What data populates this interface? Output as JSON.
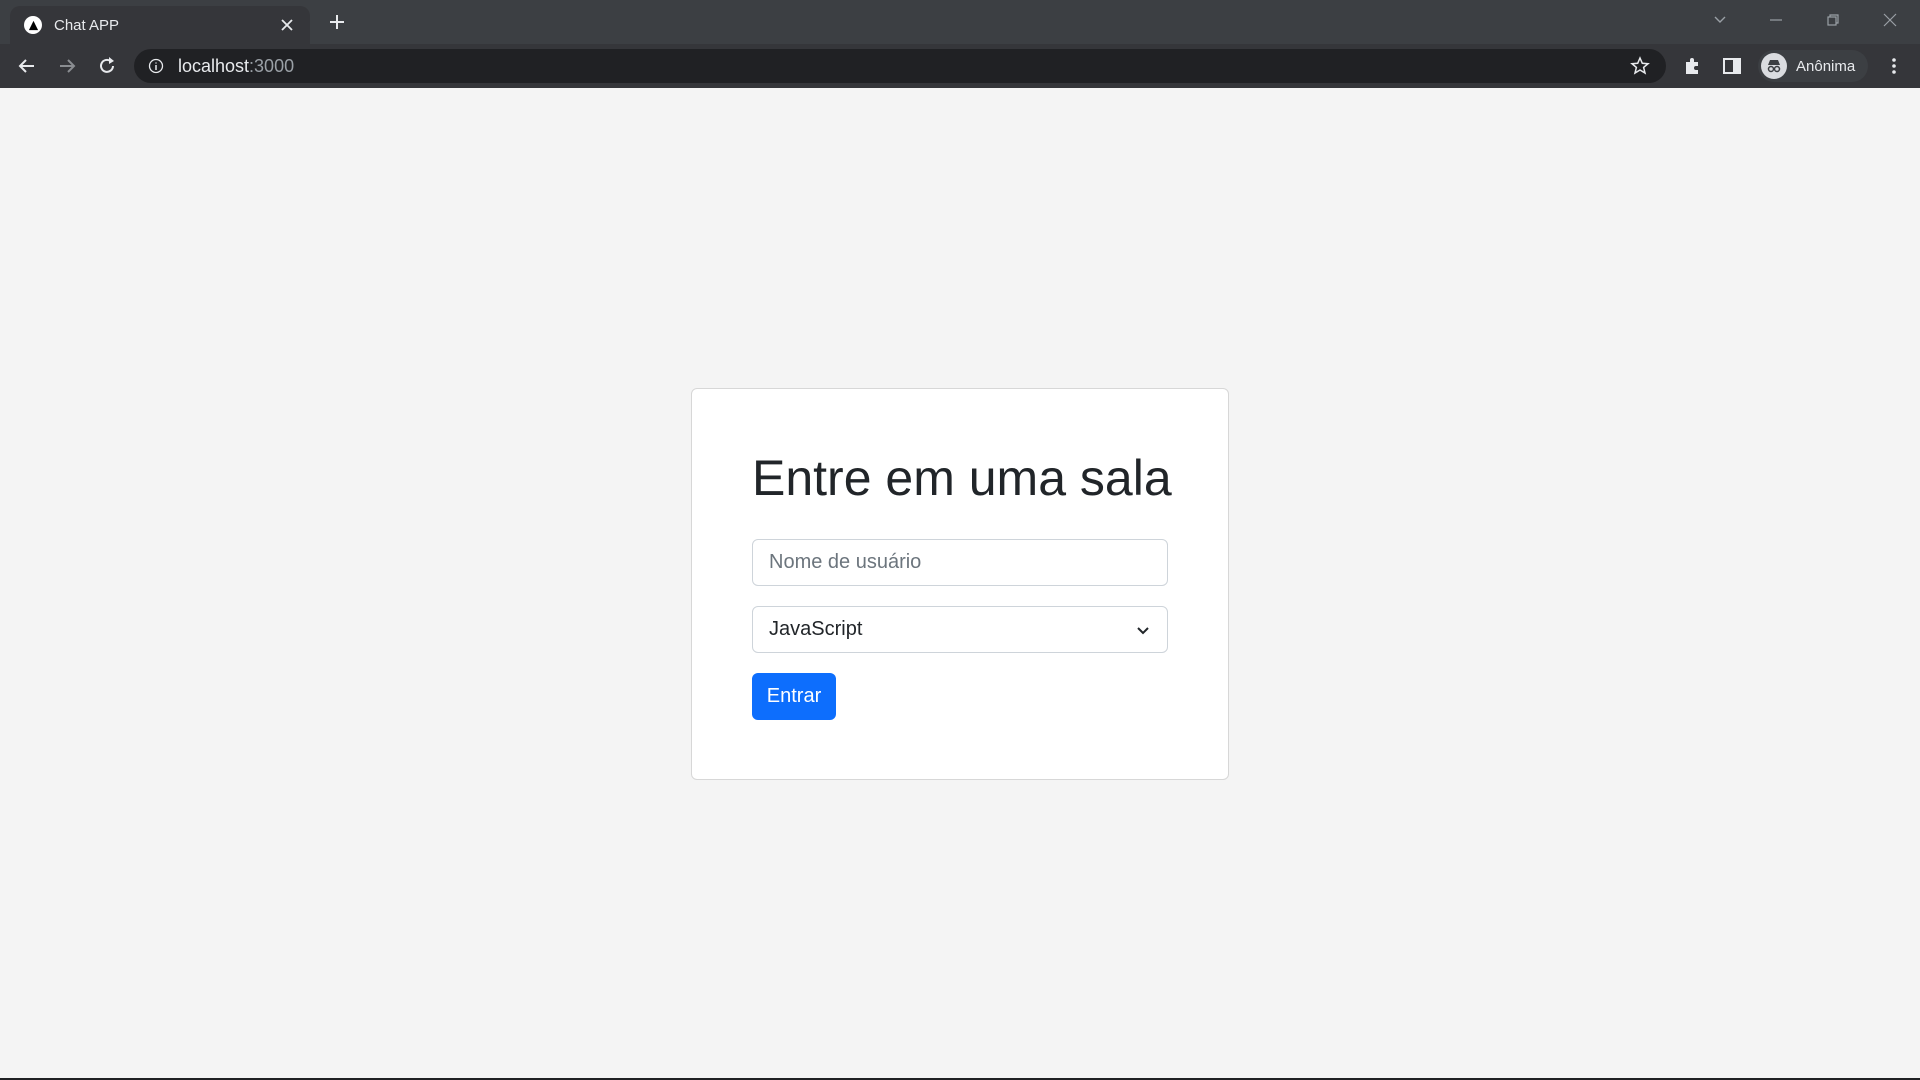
{
  "browser": {
    "tab_title": "Chat APP",
    "url_host": "localhost",
    "url_port": ":3000",
    "profile_label": "Anônima"
  },
  "page": {
    "heading": "Entre em uma sala",
    "username_placeholder": "Nome de usuário",
    "username_value": "",
    "room_select_value": "JavaScript",
    "submit_label": "Entrar"
  },
  "colors": {
    "primary_button": "#0d6efd",
    "page_background": "#f4f4f4",
    "card_background": "#ffffff"
  }
}
